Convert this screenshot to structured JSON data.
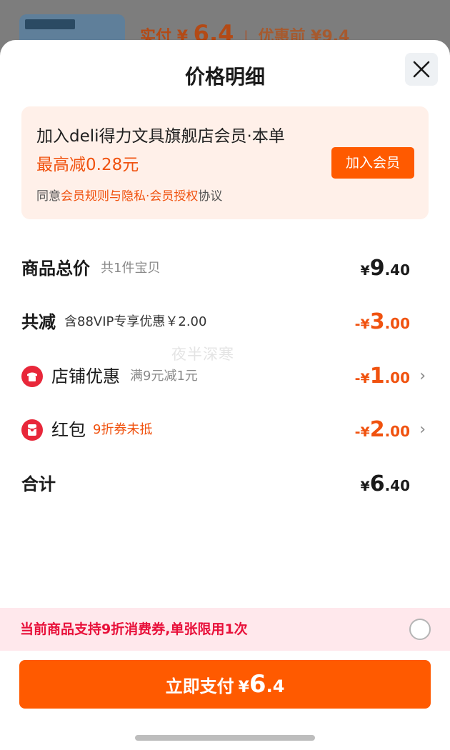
{
  "background": {
    "price_prefix": "实付",
    "price_currency": "¥",
    "price_value": "6.4",
    "divider": "|",
    "orig_label": "优惠前",
    "orig_value": "¥9.4"
  },
  "sheet": {
    "title": "价格明细"
  },
  "member": {
    "line_a": "加入deli得力文具旗舰店会员·本单",
    "highlight": "最高减0.28元",
    "agree_prefix": "同意",
    "agree_link": "会员规则与隐私·会员授权",
    "agree_suffix": "协议",
    "join_label": "加入会员"
  },
  "rows": {
    "total": {
      "label": "商品总价",
      "sub": "共1件宝贝",
      "currency": "¥",
      "int": "9",
      "dec": ".40"
    },
    "reduce": {
      "label": "共减",
      "sub": "含88VIP专享优惠￥2.00",
      "currency": "-¥",
      "int": "3",
      "dec": ".00"
    },
    "shop": {
      "label": "店铺优惠",
      "sub": "满9元减1元",
      "currency": "-¥",
      "int": "1",
      "dec": ".00",
      "chevron": "›"
    },
    "redpack": {
      "label": "红包",
      "sub": "9折券未抵",
      "currency": "-¥",
      "int": "2",
      "dec": ".00",
      "chevron": "›"
    },
    "sum": {
      "label": "合计",
      "currency": "¥",
      "int": "6",
      "dec": ".40"
    }
  },
  "watermark": "夜半深寒",
  "coupon": {
    "text": "当前商品支持9折消费券,单张限用1次"
  },
  "pay": {
    "label": "立即支付",
    "currency": "¥",
    "int": "6",
    "dec": ".4"
  },
  "colors": {
    "accent": "#ff5a00",
    "discount": "#f0520f",
    "coupon_text": "#e8103a",
    "icon_red": "#e8273a"
  },
  "icons": {
    "close": "close-icon",
    "shop": "shop-icon",
    "redpack": "red-envelope-icon"
  }
}
